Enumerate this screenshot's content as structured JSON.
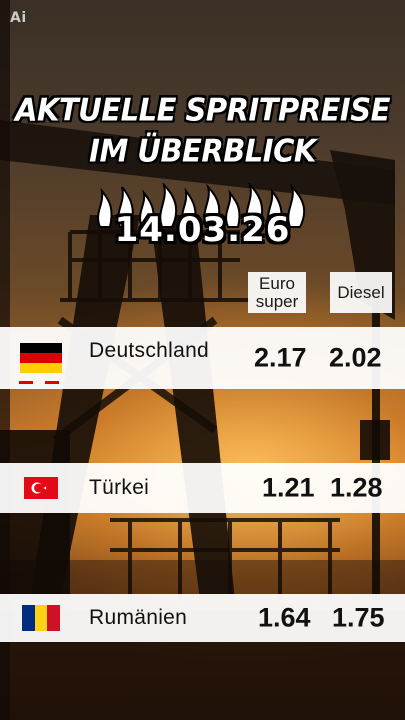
{
  "watermark": "Ai",
  "title": {
    "line1": "AKTUELLE SPRITPREISE",
    "line2": "IM ÜBERBLICK"
  },
  "date": "14.03.26",
  "columns": {
    "super": "Euro super",
    "diesel": "Diesel"
  },
  "rows": [
    {
      "country": "Deutschland",
      "flag": "germany-flag-icon",
      "super": "2.17",
      "diesel": "2.02"
    },
    {
      "country": "Türkei",
      "flag": "turkey-flag-icon",
      "super": "1.21",
      "diesel": "1.28"
    },
    {
      "country": "Rumänien",
      "flag": "romania-flag-icon",
      "super": "1.64",
      "diesel": "1.75"
    }
  ],
  "colors": {
    "germany": [
      "#000000",
      "#DD0000",
      "#FFCE00"
    ],
    "turkey": "#E30A17",
    "romania": [
      "#002B7F",
      "#FCD116",
      "#CE1126"
    ]
  }
}
